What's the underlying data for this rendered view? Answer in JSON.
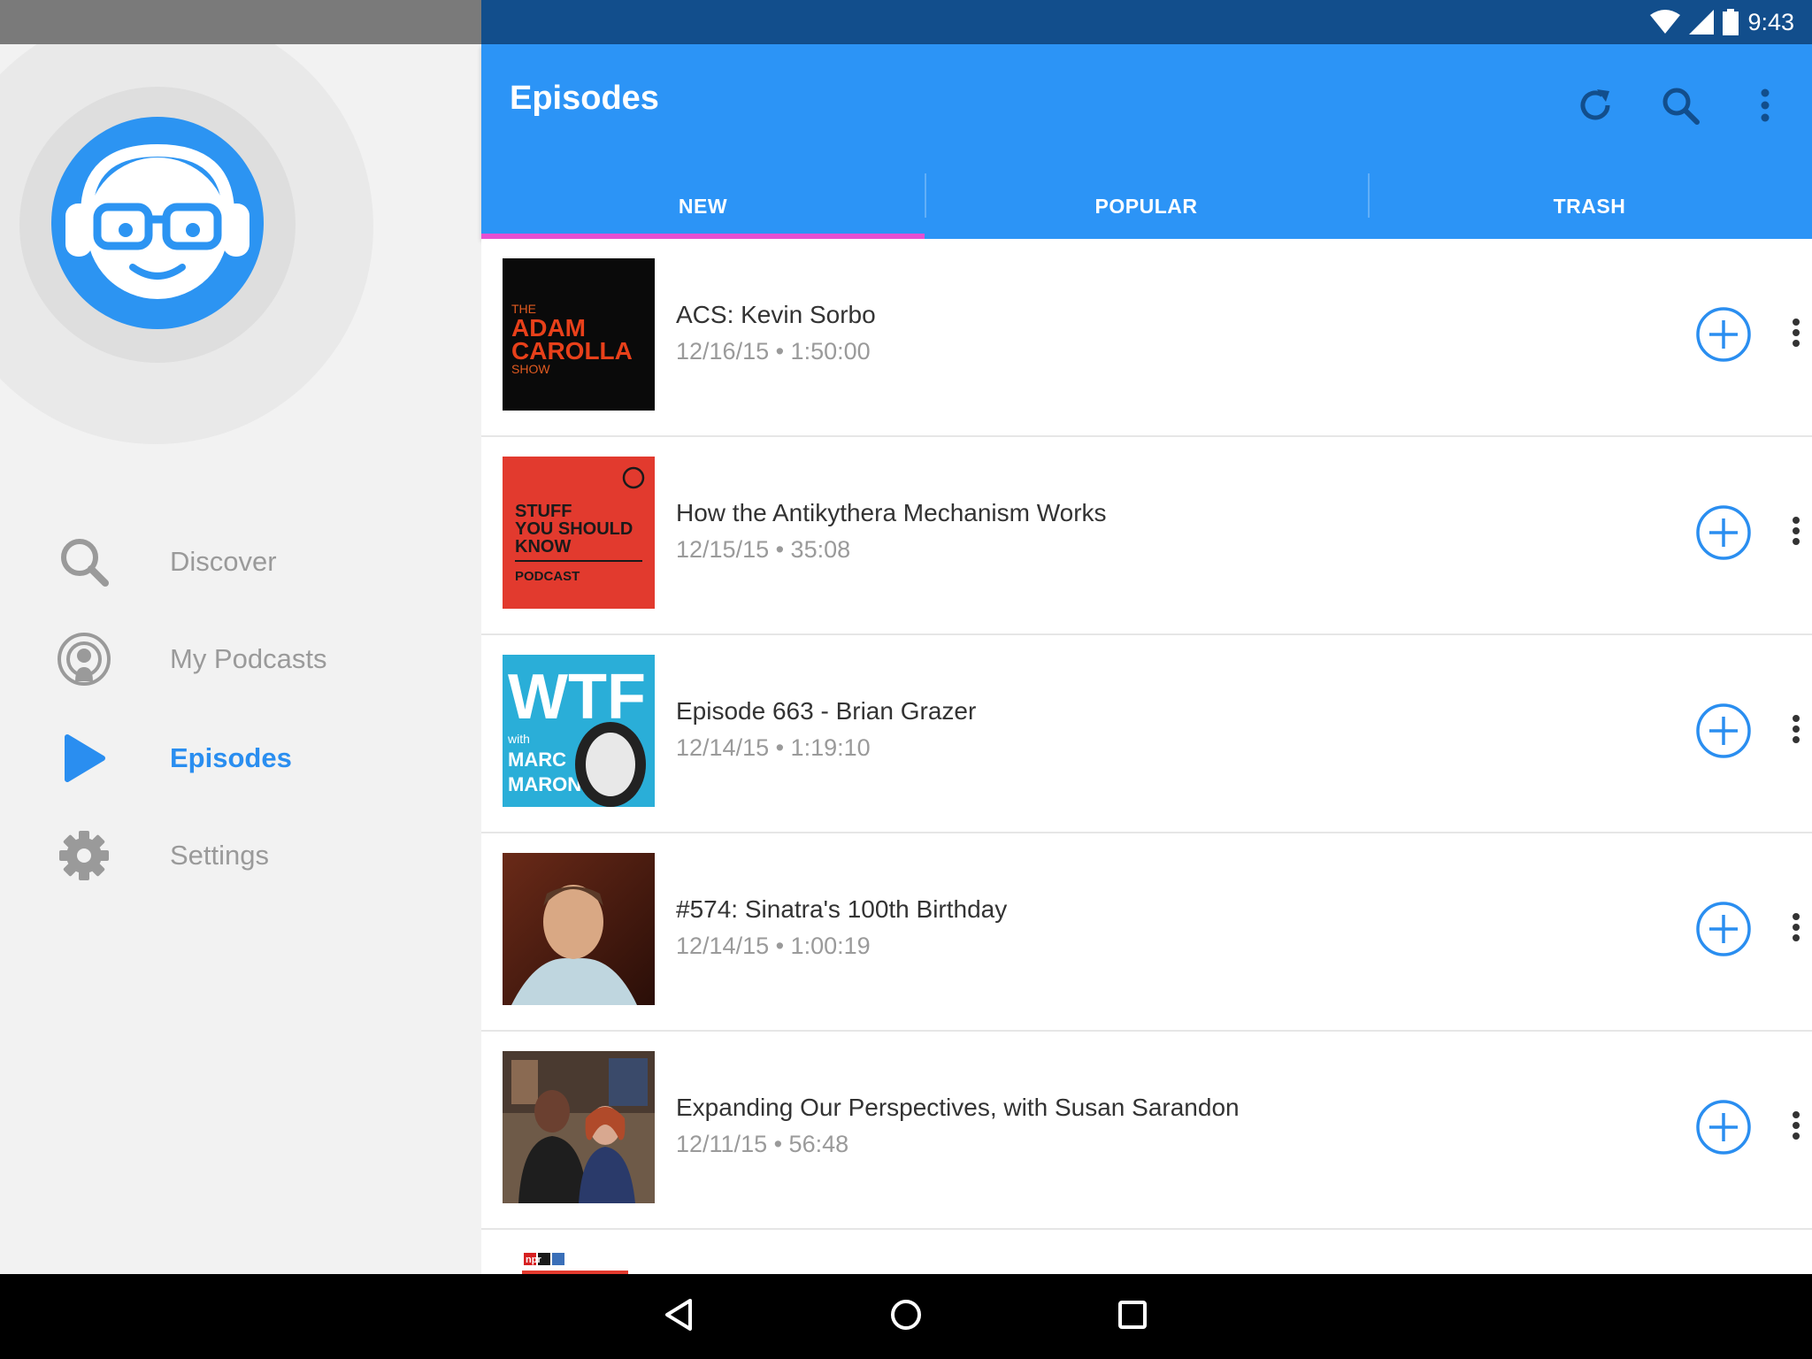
{
  "status_bar": {
    "time": "9:43"
  },
  "sidebar": {
    "items": [
      {
        "label": "Discover",
        "icon": "search-icon",
        "active": false
      },
      {
        "label": "My Podcasts",
        "icon": "podcast-icon",
        "active": false
      },
      {
        "label": "Episodes",
        "icon": "play-icon",
        "active": true
      },
      {
        "label": "Settings",
        "icon": "gear-icon",
        "active": false
      }
    ]
  },
  "appbar": {
    "title": "Episodes",
    "actions": [
      "refresh-icon",
      "search-icon",
      "more-vert-icon"
    ]
  },
  "tabs": [
    {
      "label": "NEW",
      "active": true
    },
    {
      "label": "POPULAR",
      "active": false
    },
    {
      "label": "TRASH",
      "active": false
    }
  ],
  "episodes": [
    {
      "title": "ACS: Kevin Sorbo",
      "meta": "12/16/15 • 1:50:00",
      "art": {
        "bg": "#0a0a0a",
        "lines": [
          "THE",
          "ADAM",
          "CAROLLA",
          "SHOW"
        ]
      }
    },
    {
      "title": "How the Antikythera Mechanism Works",
      "meta": "12/15/15 • 35:08",
      "art": {
        "bg": "#e23a2e",
        "lines": [
          "STUFF",
          "YOU SHOULD",
          "KNOW",
          "PODCAST"
        ]
      }
    },
    {
      "title": "Episode 663 - Brian Grazer",
      "meta": "12/14/15 • 1:19:10",
      "art": {
        "bg": "#2aaed8",
        "lines": [
          "WTF",
          "with",
          "MARC",
          "MARON"
        ]
      }
    },
    {
      "title": "#574: Sinatra's 100th Birthday",
      "meta": "12/14/15 • 1:00:19",
      "art": {
        "bg": "#5a2a1c",
        "lines": []
      }
    },
    {
      "title": "Expanding Our Perspectives, with Susan Sarandon",
      "meta": "12/11/15 • 56:48",
      "art": {
        "bg": "#6e5a48",
        "lines": []
      }
    }
  ],
  "partial_item": {
    "art_text": "npr"
  },
  "colors": {
    "primary": "#2c94f6",
    "accent": "#e64fd2",
    "active_text": "#2a8ef0"
  }
}
